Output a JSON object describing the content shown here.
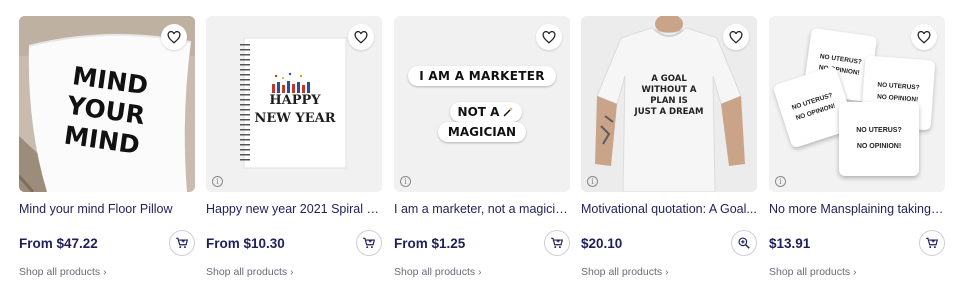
{
  "products": [
    {
      "title": "Mind your mind Floor Pillow",
      "price": "From $47.22",
      "shop_link": "Shop all products",
      "action_icon": "cart-plus-icon",
      "art_lines": [
        "MIND",
        "YOUR",
        "MIND"
      ]
    },
    {
      "title": "Happy new year 2021 Spiral N...",
      "price": "From $10.30",
      "shop_link": "Shop all products",
      "action_icon": "cart-plus-icon",
      "art_lines": [
        "HAPPY",
        "NEW YEAR"
      ]
    },
    {
      "title": "I am a marketer, not a magicia...",
      "price": "From $1.25",
      "shop_link": "Shop all products",
      "action_icon": "cart-plus-icon",
      "art_lines": [
        "I AM A MARKETER",
        "NOT A",
        "MAGICIAN"
      ]
    },
    {
      "title": "Motivational quotation: A Goal...",
      "price": "$20.10",
      "shop_link": "Shop all products",
      "action_icon": "zoom-in-icon",
      "art_lines": [
        "A GOAL",
        "WITHOUT A",
        "PLAN IS",
        "JUST A DREAM"
      ]
    },
    {
      "title": "No more Mansplaining taking f...",
      "price": "$13.91",
      "shop_link": "Shop all products",
      "action_icon": "cart-plus-icon",
      "art_lines": [
        "NO UTERUS?",
        "NO OPINION!"
      ]
    }
  ],
  "colors": {
    "text": "#1f1f5c",
    "muted": "#6b6b7b",
    "border": "#cfcfd8"
  }
}
